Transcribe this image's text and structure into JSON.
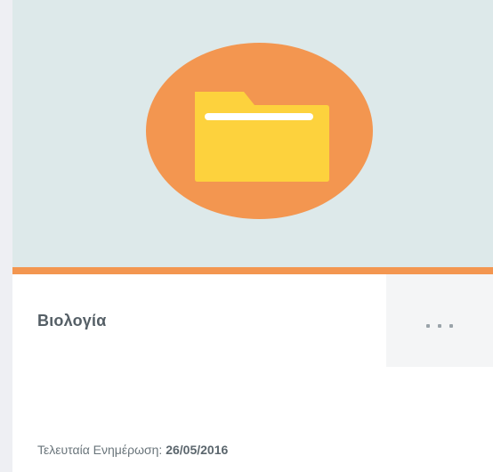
{
  "card": {
    "title": "Βιολογία",
    "more_label": "...",
    "last_updated_label": "Τελευταία Ενημέρωση:",
    "last_updated_date": "26/05/2016",
    "icon": "folder-icon"
  },
  "colors": {
    "thumbnail_bg": "#dde9ea",
    "accent": "#f39650",
    "folder": "#fdd23d"
  }
}
